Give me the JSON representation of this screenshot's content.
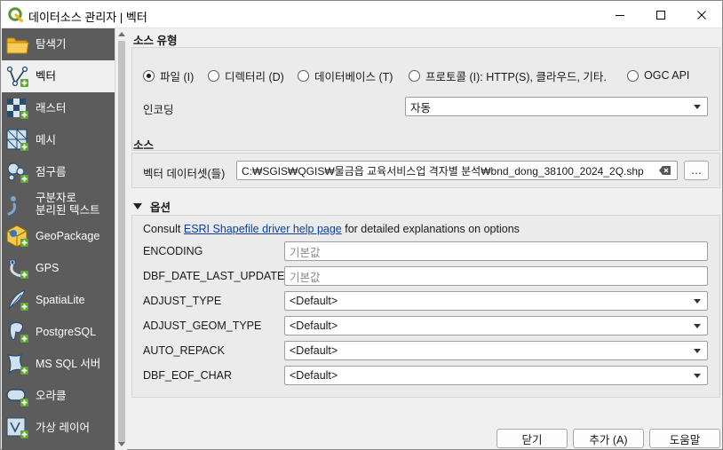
{
  "window": {
    "title": "데이터소스 관리자 | 벡터"
  },
  "sidebar": {
    "items": [
      {
        "label": "탐색기",
        "icon": "folder-icon"
      },
      {
        "label": "벡터",
        "icon": "vector-icon"
      },
      {
        "label": "래스터",
        "icon": "raster-icon"
      },
      {
        "label": "메시",
        "icon": "mesh-icon"
      },
      {
        "label": "점구름",
        "icon": "point-cloud-icon"
      },
      {
        "label_line1": "구분자로",
        "label_line2": "분리된 텍스트",
        "icon": "delimited-text-icon"
      },
      {
        "label": "GeoPackage",
        "icon": "geopackage-icon"
      },
      {
        "label": "GPS",
        "icon": "gps-icon"
      },
      {
        "label": "SpatiaLite",
        "icon": "spatialite-icon"
      },
      {
        "label": "PostgreSQL",
        "icon": "postgresql-icon"
      },
      {
        "label": "MS SQL 서버",
        "icon": "mssql-icon"
      },
      {
        "label": "오라클",
        "icon": "oracle-icon"
      },
      {
        "label": "가상 레이어",
        "icon": "virtual-layer-icon"
      }
    ]
  },
  "source_type": {
    "title": "소스 유형",
    "options": [
      "파일 (I)",
      "디렉터리 (D)",
      "데이터베이스 (T)",
      "프로토콜 (I): HTTP(S), 클라우드, 기타.",
      "OGC API"
    ],
    "selected_index": 0,
    "encoding_label": "인코딩",
    "encoding_value": "자동"
  },
  "source": {
    "title": "소스",
    "dataset_label": "벡터 데이터셋(들)",
    "dataset_value": "C:₩SGIS₩QGIS₩물금읍 교육서비스업 격자별 분석₩bnd_dong_38100_2024_2Q.shp",
    "browse_label": "…"
  },
  "options": {
    "title": "옵션",
    "consult_prefix": "Consult ",
    "consult_link": "ESRI Shapefile driver help page",
    "consult_suffix": " for detailed explanations on options",
    "rows": [
      {
        "label": "ENCODING",
        "value": "기본값",
        "kind": "text"
      },
      {
        "label": "DBF_DATE_LAST_UPDATE",
        "value": "기본값",
        "kind": "text"
      },
      {
        "label": "ADJUST_TYPE",
        "value": "<Default>",
        "kind": "combo"
      },
      {
        "label": "ADJUST_GEOM_TYPE",
        "value": "<Default>",
        "kind": "combo"
      },
      {
        "label": "AUTO_REPACK",
        "value": "<Default>",
        "kind": "combo"
      },
      {
        "label": "DBF_EOF_CHAR",
        "value": "<Default>",
        "kind": "combo"
      }
    ]
  },
  "buttons": {
    "close": "닫기",
    "add": "추가 (A)",
    "help": "도움말"
  }
}
